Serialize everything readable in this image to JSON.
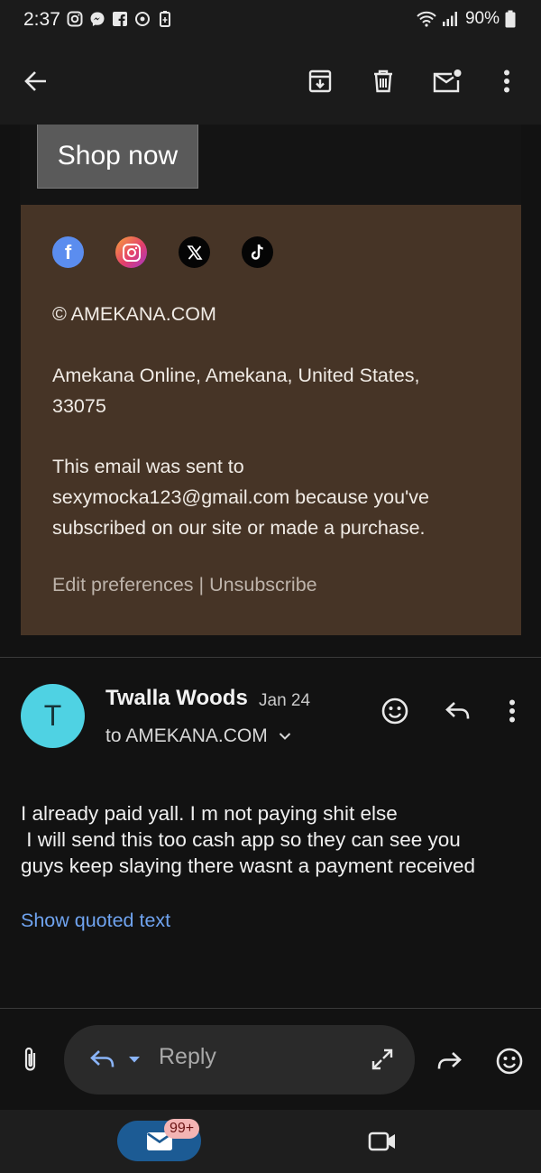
{
  "status_bar": {
    "time": "2:37",
    "battery": "90%"
  },
  "app_bar": {
    "icons": [
      "back-arrow-icon",
      "archive-icon",
      "delete-icon",
      "mark-unread-icon",
      "more-vert-icon"
    ]
  },
  "email_body": {
    "cta_label": "Shop now",
    "social_icons": [
      "facebook-icon",
      "instagram-icon",
      "x-icon",
      "tiktok-icon"
    ],
    "copyright": "© AMEKANA.COM",
    "address_line1": "Amekana Online, Amekana, United States,",
    "address_line2": "33075",
    "notice_line1": "This email was sent to",
    "notice_line2": "sexymocka123@gmail.com because you've",
    "notice_line3": "subscribed on our site or made a purchase.",
    "edit_preferences": "Edit preferences",
    "separator": "|",
    "unsubscribe": "Unsubscribe",
    "colors": {
      "footer_bg": "#463426",
      "button_bg": "#5a5a5a"
    }
  },
  "message": {
    "avatar_initial": "T",
    "avatar_color": "#4fd2e3",
    "sender": "Twalla Woods",
    "date": "Jan 24",
    "recipient": "to AMEKANA.COM",
    "lines": [
      "I already paid yall. I m not paying shit else",
      " I will send this too cash app so they can see you",
      "guys keep slaying there wasnt a payment received"
    ],
    "show_quoted": "Show quoted text"
  },
  "reply_bar": {
    "placeholder": "Reply"
  },
  "bottom_nav": {
    "mail_badge": "99+",
    "accent": "#1c5b94"
  }
}
